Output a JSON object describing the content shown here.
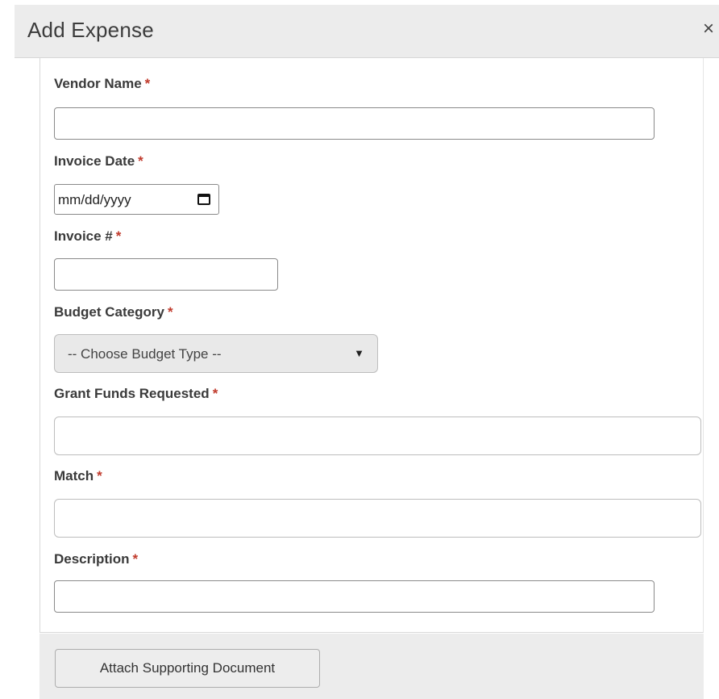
{
  "modal": {
    "title": "Add Expense",
    "close_glyph": "×"
  },
  "form": {
    "required_marker": "*",
    "vendor_name": {
      "label": "Vendor Name",
      "value": ""
    },
    "invoice_date": {
      "label": "Invoice Date",
      "placeholder": "mm/dd/yyyy"
    },
    "invoice_number": {
      "label": "Invoice #",
      "value": ""
    },
    "budget_category": {
      "label": "Budget Category",
      "selected": "-- Choose Budget Type --",
      "arrow": "▼"
    },
    "grant_funds_requested": {
      "label": "Grant Funds Requested",
      "value": ""
    },
    "match": {
      "label": "Match",
      "value": ""
    },
    "description": {
      "label": "Description",
      "value": ""
    }
  },
  "footer": {
    "attach_button_label": "Attach Supporting Document"
  },
  "colors": {
    "required": "#c0392b",
    "header_bg": "#ececec",
    "select_bg": "#e9e9e9"
  },
  "icons": {
    "close": "close-icon",
    "calendar": "calendar-icon",
    "dropdown": "chevron-down-icon"
  }
}
